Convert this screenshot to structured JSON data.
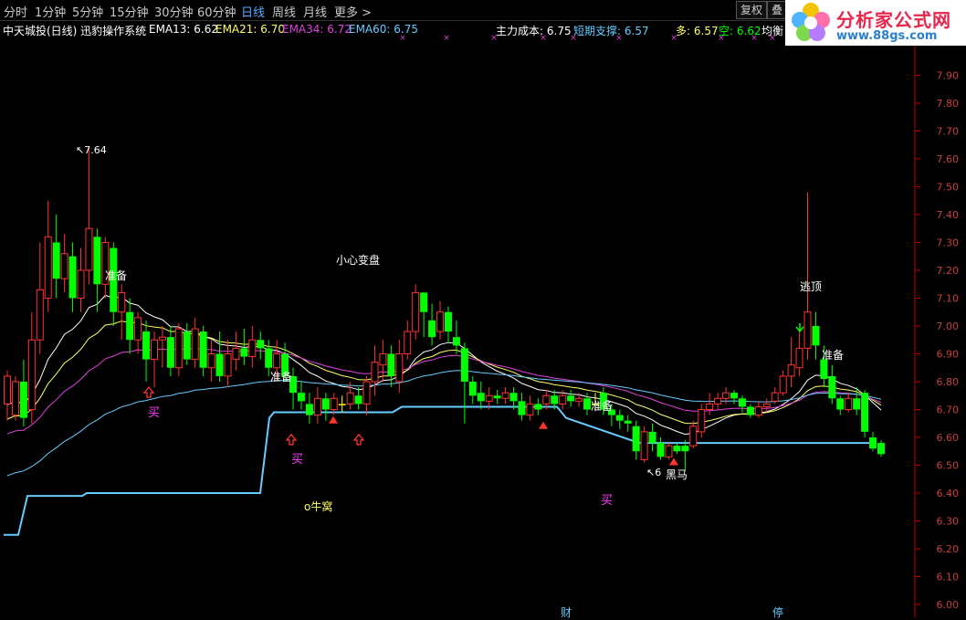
{
  "toolbar": {
    "tabs": [
      "分时",
      "1分钟",
      "5分钟",
      "15分钟",
      "30分钟",
      "60分钟",
      "日线",
      "周线",
      "月线",
      "更多 >"
    ],
    "active_tab": "日线",
    "btn_fq": "复权",
    "btn_overlay": "叠"
  },
  "info": {
    "title": "中天城投(日线) 迅豹操作系统",
    "ema13_label": "EMA13:",
    "ema13_val": "6.62",
    "ema21_label": "EMA21:",
    "ema21_val": "6.70",
    "ema34_label": "EMA34:",
    "ema34_val": "6.72",
    "ema60_label": "EMA60:",
    "ema60_val": "6.75",
    "zlcb_label": "主力成本:",
    "zlcb_val": "6.75",
    "dqzc_label": "短期支撑:",
    "dqzc_val": "6.57",
    "duo_label": "多:",
    "duo_val": "6.57",
    "kong_label": "空:",
    "kong_val": "6.62",
    "junheng": "均衡"
  },
  "colors": {
    "up": "#ff3232",
    "down": "#00ff00",
    "flat": "#ffff00",
    "ema13": "#ffffff",
    "ema21": "#ffff66",
    "ema34": "#e040e0",
    "ema60": "#66ccff",
    "support": "#66ccff",
    "axis": "#c00000",
    "label_white": "#ffffff",
    "label_magenta": "#ff40ff"
  },
  "logo": {
    "title": "分析家公式网",
    "url": "www.88gs.com"
  },
  "chart_data": {
    "type": "candlestick",
    "yaxis_ticks": [
      "7.90",
      "7.80",
      "7.70",
      "7.60",
      "7.50",
      "7.40",
      "7.30",
      "7.20",
      "7.10",
      "7.00",
      "6.90",
      "6.80",
      "6.70",
      "6.60",
      "6.50",
      "6.40",
      "6.30",
      "6.20",
      "6.10",
      "6.00"
    ],
    "ylim": [
      6.0,
      7.95
    ],
    "annotations": {
      "high_mark": "7.64",
      "zhunbei1": "准备",
      "zhunbei2": "准备",
      "zhunbei3": "准备",
      "zhunbei4": "准备",
      "xiaoxin": "小心变盘",
      "taoding": "逃顶",
      "mai1": "买",
      "mai2": "买",
      "mai3": "买",
      "niuwo": "o牛窝",
      "heima": "黑马",
      "low_mark": "6",
      "cai": "财",
      "ting": "停"
    },
    "candles": [
      {
        "o": 6.72,
        "c": 6.82,
        "h": 6.84,
        "l": 6.66
      },
      {
        "o": 6.68,
        "c": 6.8,
        "h": 6.82,
        "l": 6.66
      },
      {
        "o": 6.8,
        "c": 6.67,
        "h": 6.88,
        "l": 6.64
      },
      {
        "o": 6.7,
        "c": 6.95,
        "h": 7.05,
        "l": 6.65
      },
      {
        "o": 6.95,
        "c": 7.13,
        "h": 7.3,
        "l": 6.9
      },
      {
        "o": 7.1,
        "c": 7.32,
        "h": 7.45,
        "l": 7.05
      },
      {
        "o": 7.3,
        "c": 7.17,
        "h": 7.4,
        "l": 7.1
      },
      {
        "o": 7.17,
        "c": 7.26,
        "h": 7.33,
        "l": 7.12
      },
      {
        "o": 7.25,
        "c": 7.1,
        "h": 7.3,
        "l": 7.05
      },
      {
        "o": 7.1,
        "c": 7.2,
        "h": 7.28,
        "l": 7.05
      },
      {
        "o": 7.2,
        "c": 7.35,
        "h": 7.64,
        "l": 7.15
      },
      {
        "o": 7.32,
        "c": 7.15,
        "h": 7.35,
        "l": 7.05
      },
      {
        "o": 7.15,
        "c": 7.3,
        "h": 7.32,
        "l": 7.1
      },
      {
        "o": 7.28,
        "c": 7.05,
        "h": 7.3,
        "l": 7.0
      },
      {
        "o": 7.05,
        "c": 7.12,
        "h": 7.15,
        "l": 6.95
      },
      {
        "o": 7.05,
        "c": 6.95,
        "h": 7.1,
        "l": 6.9
      },
      {
        "o": 6.95,
        "c": 7.03,
        "h": 7.05,
        "l": 6.9
      },
      {
        "o": 6.98,
        "c": 6.88,
        "h": 7.02,
        "l": 6.8
      },
      {
        "o": 6.88,
        "c": 6.95,
        "h": 6.98,
        "l": 6.78
      },
      {
        "o": 6.95,
        "c": 6.96,
        "h": 7.0,
        "l": 6.85
      },
      {
        "o": 6.96,
        "c": 6.85,
        "h": 7.0,
        "l": 6.82
      },
      {
        "o": 6.85,
        "c": 6.99,
        "h": 7.01,
        "l": 6.82
      },
      {
        "o": 6.98,
        "c": 6.88,
        "h": 7.01,
        "l": 6.86
      },
      {
        "o": 6.88,
        "c": 6.99,
        "h": 7.03,
        "l": 6.85
      },
      {
        "o": 6.98,
        "c": 6.85,
        "h": 7.0,
        "l": 6.82
      },
      {
        "o": 6.85,
        "c": 6.9,
        "h": 6.95,
        "l": 6.8
      },
      {
        "o": 6.9,
        "c": 6.82,
        "h": 6.98,
        "l": 6.8
      },
      {
        "o": 6.82,
        "c": 6.9,
        "h": 6.95,
        "l": 6.78
      },
      {
        "o": 6.88,
        "c": 6.92,
        "h": 6.98,
        "l": 6.84
      },
      {
        "o": 6.92,
        "c": 6.89,
        "h": 6.99,
        "l": 6.86
      },
      {
        "o": 6.89,
        "c": 6.95,
        "h": 7.0,
        "l": 6.85
      },
      {
        "o": 6.95,
        "c": 6.92,
        "h": 6.98,
        "l": 6.88
      },
      {
        "o": 6.92,
        "c": 6.85,
        "h": 6.95,
        "l": 6.82
      },
      {
        "o": 6.85,
        "c": 6.9,
        "h": 6.95,
        "l": 6.8
      },
      {
        "o": 6.9,
        "c": 6.82,
        "h": 6.94,
        "l": 6.8
      },
      {
        "o": 6.82,
        "c": 6.76,
        "h": 6.85,
        "l": 6.7
      },
      {
        "o": 6.76,
        "c": 6.73,
        "h": 6.8,
        "l": 6.7
      },
      {
        "o": 6.72,
        "c": 6.68,
        "h": 6.76,
        "l": 6.65
      },
      {
        "o": 6.68,
        "c": 6.74,
        "h": 6.78,
        "l": 6.65
      },
      {
        "o": 6.74,
        "c": 6.7,
        "h": 6.76,
        "l": 6.66
      },
      {
        "o": 6.7,
        "c": 6.74,
        "h": 6.76,
        "l": 6.68
      },
      {
        "o": 6.72,
        "c": 6.72,
        "h": 6.75,
        "l": 6.69
      },
      {
        "o": 6.72,
        "c": 6.76,
        "h": 6.8,
        "l": 6.7
      },
      {
        "o": 6.75,
        "c": 6.72,
        "h": 6.78,
        "l": 6.7
      },
      {
        "o": 6.72,
        "c": 6.8,
        "h": 6.82,
        "l": 6.68
      },
      {
        "o": 6.8,
        "c": 6.87,
        "h": 6.93,
        "l": 6.75
      },
      {
        "o": 6.86,
        "c": 6.9,
        "h": 6.95,
        "l": 6.8
      },
      {
        "o": 6.9,
        "c": 6.82,
        "h": 6.93,
        "l": 6.78
      },
      {
        "o": 6.8,
        "c": 6.9,
        "h": 6.95,
        "l": 6.76
      },
      {
        "o": 6.9,
        "c": 6.98,
        "h": 7.02,
        "l": 6.88
      },
      {
        "o": 6.98,
        "c": 7.12,
        "h": 7.15,
        "l": 6.95
      },
      {
        "o": 7.12,
        "c": 7.05,
        "h": 7.1,
        "l": 6.96
      },
      {
        "o": 7.02,
        "c": 6.96,
        "h": 7.08,
        "l": 6.93
      },
      {
        "o": 6.98,
        "c": 7.05,
        "h": 7.09,
        "l": 6.95
      },
      {
        "o": 7.05,
        "c": 6.98,
        "h": 7.07,
        "l": 6.94
      },
      {
        "o": 6.96,
        "c": 6.93,
        "h": 7.02,
        "l": 6.9
      },
      {
        "o": 6.92,
        "c": 6.8,
        "h": 6.94,
        "l": 6.65
      },
      {
        "o": 6.8,
        "c": 6.75,
        "h": 6.82,
        "l": 6.72
      },
      {
        "o": 6.76,
        "c": 6.73,
        "h": 6.8,
        "l": 6.7
      },
      {
        "o": 6.73,
        "c": 6.75,
        "h": 6.78,
        "l": 6.7
      },
      {
        "o": 6.75,
        "c": 6.74,
        "h": 6.77,
        "l": 6.72
      },
      {
        "o": 6.74,
        "c": 6.76,
        "h": 6.78,
        "l": 6.72
      },
      {
        "o": 6.76,
        "c": 6.73,
        "h": 6.78,
        "l": 6.7
      },
      {
        "o": 6.73,
        "c": 6.68,
        "h": 6.76,
        "l": 6.66
      },
      {
        "o": 6.68,
        "c": 6.72,
        "h": 6.75,
        "l": 6.66
      },
      {
        "o": 6.72,
        "c": 6.7,
        "h": 6.74,
        "l": 6.68
      },
      {
        "o": 6.72,
        "c": 6.75,
        "h": 6.77,
        "l": 6.7
      },
      {
        "o": 6.75,
        "c": 6.72,
        "h": 6.77,
        "l": 6.7
      },
      {
        "o": 6.72,
        "c": 6.75,
        "h": 6.77,
        "l": 6.7
      },
      {
        "o": 6.75,
        "c": 6.73,
        "h": 6.77,
        "l": 6.71
      },
      {
        "o": 6.73,
        "c": 6.74,
        "h": 6.76,
        "l": 6.71
      },
      {
        "o": 6.74,
        "c": 6.7,
        "h": 6.76,
        "l": 6.68
      },
      {
        "o": 6.72,
        "c": 6.72,
        "h": 6.76,
        "l": 6.7
      },
      {
        "o": 6.76,
        "c": 6.7,
        "h": 6.78,
        "l": 6.68
      },
      {
        "o": 6.7,
        "c": 6.68,
        "h": 6.72,
        "l": 6.64
      },
      {
        "o": 6.68,
        "c": 6.66,
        "h": 6.7,
        "l": 6.63
      },
      {
        "o": 6.66,
        "c": 6.65,
        "h": 6.68,
        "l": 6.62
      },
      {
        "o": 6.64,
        "c": 6.55,
        "h": 6.66,
        "l": 6.52
      },
      {
        "o": 6.52,
        "c": 6.62,
        "h": 6.64,
        "l": 6.51
      },
      {
        "o": 6.62,
        "c": 6.58,
        "h": 6.65,
        "l": 6.55
      },
      {
        "o": 6.58,
        "c": 6.53,
        "h": 6.6,
        "l": 6.52
      },
      {
        "o": 6.53,
        "c": 6.57,
        "h": 6.58,
        "l": 6.52
      },
      {
        "o": 6.57,
        "c": 6.55,
        "h": 6.58,
        "l": 6.54
      },
      {
        "o": 6.57,
        "c": 6.55,
        "h": 6.59,
        "l": 6.48
      },
      {
        "o": 6.57,
        "c": 6.64,
        "h": 6.66,
        "l": 6.56
      },
      {
        "o": 6.62,
        "c": 6.7,
        "h": 6.72,
        "l": 6.6
      },
      {
        "o": 6.7,
        "c": 6.72,
        "h": 6.76,
        "l": 6.68
      },
      {
        "o": 6.72,
        "c": 6.74,
        "h": 6.76,
        "l": 6.7
      },
      {
        "o": 6.74,
        "c": 6.76,
        "h": 6.78,
        "l": 6.72
      },
      {
        "o": 6.76,
        "c": 6.74,
        "h": 6.77,
        "l": 6.72
      },
      {
        "o": 6.74,
        "c": 6.71,
        "h": 6.75,
        "l": 6.69
      },
      {
        "o": 6.71,
        "c": 6.68,
        "h": 6.72,
        "l": 6.67
      },
      {
        "o": 6.68,
        "c": 6.71,
        "h": 6.73,
        "l": 6.67
      },
      {
        "o": 6.71,
        "c": 6.72,
        "h": 6.74,
        "l": 6.69
      },
      {
        "o": 6.73,
        "c": 6.76,
        "h": 6.78,
        "l": 6.72
      },
      {
        "o": 6.76,
        "c": 6.82,
        "h": 6.84,
        "l": 6.75
      },
      {
        "o": 6.82,
        "c": 6.86,
        "h": 6.96,
        "l": 6.78
      },
      {
        "o": 6.85,
        "c": 6.92,
        "h": 6.98,
        "l": 6.82
      },
      {
        "o": 6.92,
        "c": 7.05,
        "h": 7.48,
        "l": 6.88
      },
      {
        "o": 7.0,
        "c": 6.93,
        "h": 7.05,
        "l": 6.88
      },
      {
        "o": 6.88,
        "c": 6.81,
        "h": 6.93,
        "l": 6.78
      },
      {
        "o": 6.82,
        "c": 6.74,
        "h": 6.86,
        "l": 6.72
      },
      {
        "o": 6.74,
        "c": 6.7,
        "h": 6.75,
        "l": 6.68
      },
      {
        "o": 6.7,
        "c": 6.74,
        "h": 6.76,
        "l": 6.69
      },
      {
        "o": 6.74,
        "c": 6.7,
        "h": 6.78,
        "l": 6.68
      },
      {
        "o": 6.76,
        "c": 6.62,
        "h": 6.77,
        "l": 6.6
      },
      {
        "o": 6.6,
        "c": 6.56,
        "h": 6.62,
        "l": 6.55
      },
      {
        "o": 6.58,
        "c": 6.54,
        "h": 6.59,
        "l": 6.53
      }
    ]
  }
}
